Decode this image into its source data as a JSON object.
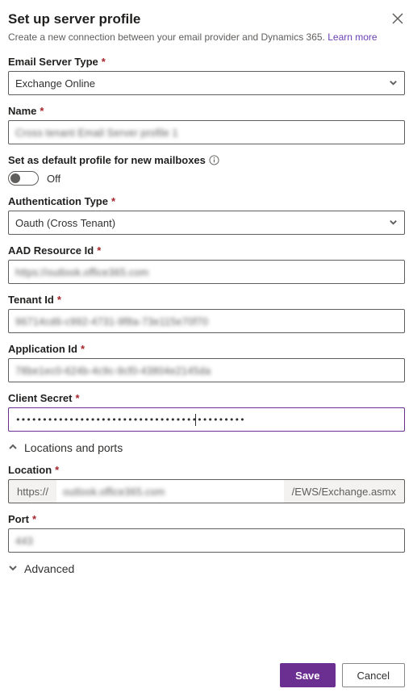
{
  "header": {
    "title": "Set up server profile",
    "subtitle": "Create a new connection between your email provider and Dynamics 365.",
    "learn_more": "Learn more"
  },
  "fields": {
    "server_type_label": "Email Server Type",
    "server_type_value": "Exchange Online",
    "name_label": "Name",
    "name_value": "Cross tenant Email Server profile 1",
    "default_label": "Set as default profile for new mailboxes",
    "default_state": "Off",
    "auth_type_label": "Authentication Type",
    "auth_type_value": "Oauth (Cross Tenant)",
    "aad_resource_label": "AAD Resource Id",
    "aad_resource_value": "https://outlook.office365.com",
    "tenant_label": "Tenant Id",
    "tenant_value": "96714cd6-c992-4731-9f8a-73e115e70f70",
    "app_id_label": "Application Id",
    "app_id_value": "78be1ec0-624b-4c9c-9cf0-43804e2145da",
    "secret_label": "Client Secret",
    "secret_value": "•••••••••••••••••••••••••••••••••••••••••••"
  },
  "sections": {
    "locations_title": "Locations and ports",
    "location_label": "Location",
    "location_prefix": "https://",
    "location_value": "outlook.office365.com",
    "location_suffix": "/EWS/Exchange.asmx",
    "port_label": "Port",
    "port_value": "443",
    "advanced_title": "Advanced"
  },
  "footer": {
    "save": "Save",
    "cancel": "Cancel"
  }
}
